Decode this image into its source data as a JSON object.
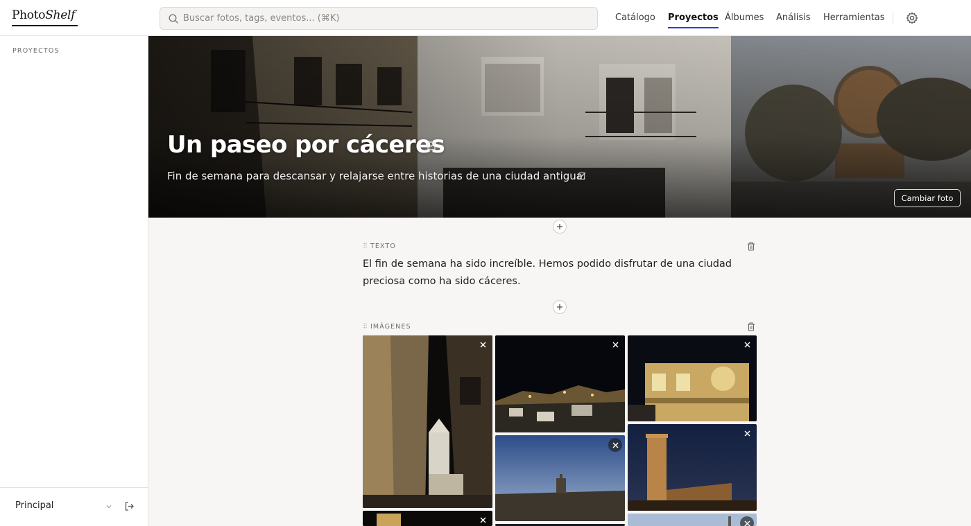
{
  "app": {
    "logo_text_a": "Photo",
    "logo_text_b": "Shelf"
  },
  "search": {
    "placeholder": "Buscar fotos, tags, eventos... (⌘K)"
  },
  "nav": {
    "items": [
      {
        "label": "Catálogo"
      },
      {
        "label": "Proyectos"
      },
      {
        "label": "Álbumes"
      },
      {
        "label": "Análisis"
      },
      {
        "label": "Herramientas"
      }
    ],
    "active": "Proyectos"
  },
  "sidebar": {
    "heading": "PROYECTOS",
    "workspace": "Principal"
  },
  "project": {
    "title": "Un paseo por cáceres",
    "subtitle": "Fin de semana para descansar y relajarse entre historias de una ciudad antigua.",
    "change_photo_label": "Cambiar foto"
  },
  "blocks": {
    "text": {
      "label": "TEXTO",
      "content": "El fin de semana ha sido increíble. Hemos podido disfrutar de una ciudad preciosa como ha sido cáceres."
    },
    "images": {
      "label": "IMÁGENES"
    }
  },
  "colors": {
    "accent": "#2b3dd6",
    "background": "#f7f6f4"
  }
}
